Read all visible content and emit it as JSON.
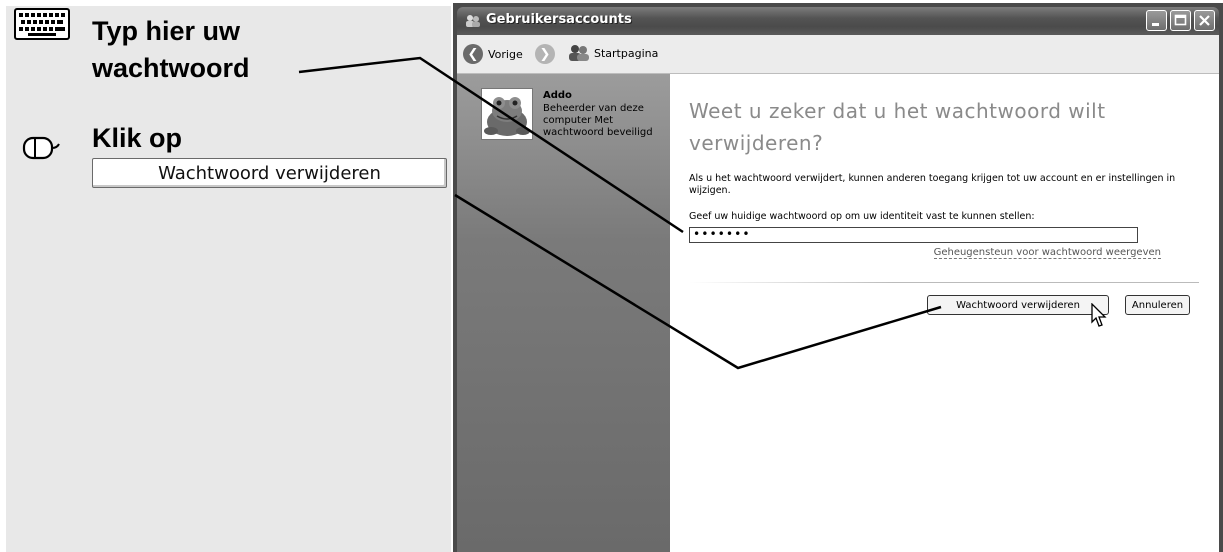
{
  "instructions": {
    "step1_line1": "Typ hier uw",
    "step1_line2": "wachtwoord",
    "step2": "Klik op",
    "step2_button": "Wachtwoord verwijderen"
  },
  "window": {
    "title": "Gebruikersaccounts",
    "toolbar": {
      "back": "Vorige",
      "home": "Startpagina"
    },
    "user": {
      "name": "Addo",
      "description": "Beheerder van deze computer Met wachtwoord beveiligd"
    },
    "heading": "Weet u zeker dat u het wachtwoord wilt verwijderen?",
    "paragraph": "Als u het wachtwoord verwijdert, kunnen anderen toegang krijgen tot uw account en er instellingen in wijzigen.",
    "prompt": "Geef uw huidige wachtwoord op om uw identiteit vast te kunnen stellen:",
    "password_value": "•••••••",
    "hint_link": "Geheugensteun voor wachtwoord weergeven",
    "remove_button": "Wachtwoord verwijderen",
    "cancel_button": "Annuleren"
  },
  "icons": {
    "keyboard": "keyboard-icon",
    "mouse": "mouse-icon",
    "back": "back-arrow-icon",
    "forward": "forward-arrow-icon",
    "home": "users-icon",
    "cursor": "pointer-cursor-icon"
  }
}
